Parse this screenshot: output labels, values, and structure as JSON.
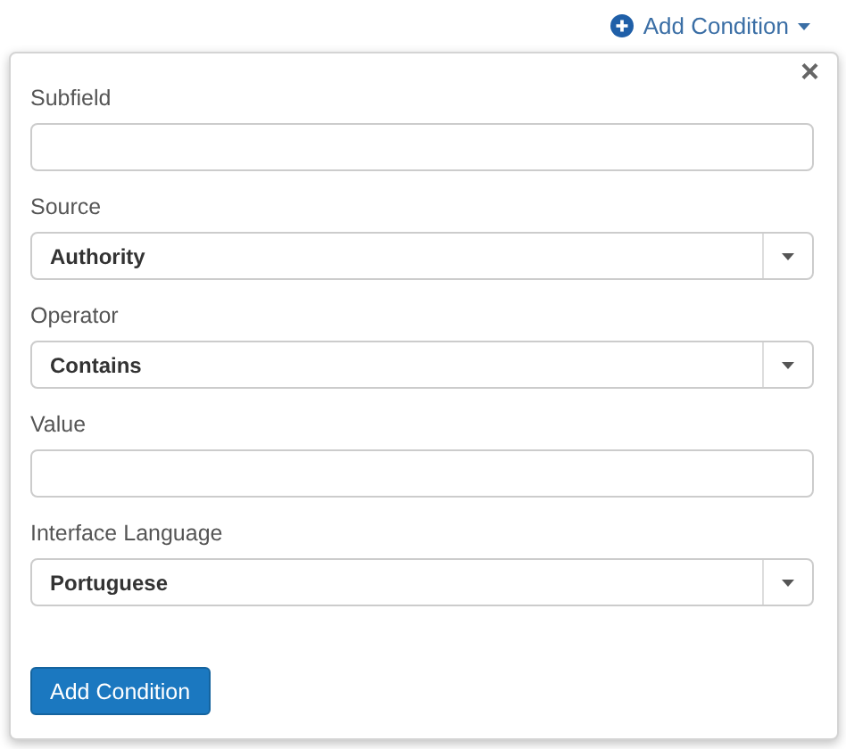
{
  "menu_link": {
    "label": "Add Condition"
  },
  "popover": {
    "close": "×",
    "fields": [
      {
        "kind": "text",
        "label": "Subfield"
      },
      {
        "kind": "select",
        "label": "Source",
        "value": "Authority"
      },
      {
        "kind": "select",
        "label": "Operator",
        "value": "Contains"
      },
      {
        "kind": "text",
        "label": "Value"
      },
      {
        "kind": "select",
        "label": "Interface Language",
        "value": "Portuguese"
      }
    ],
    "submit": "Add Condition"
  }
}
